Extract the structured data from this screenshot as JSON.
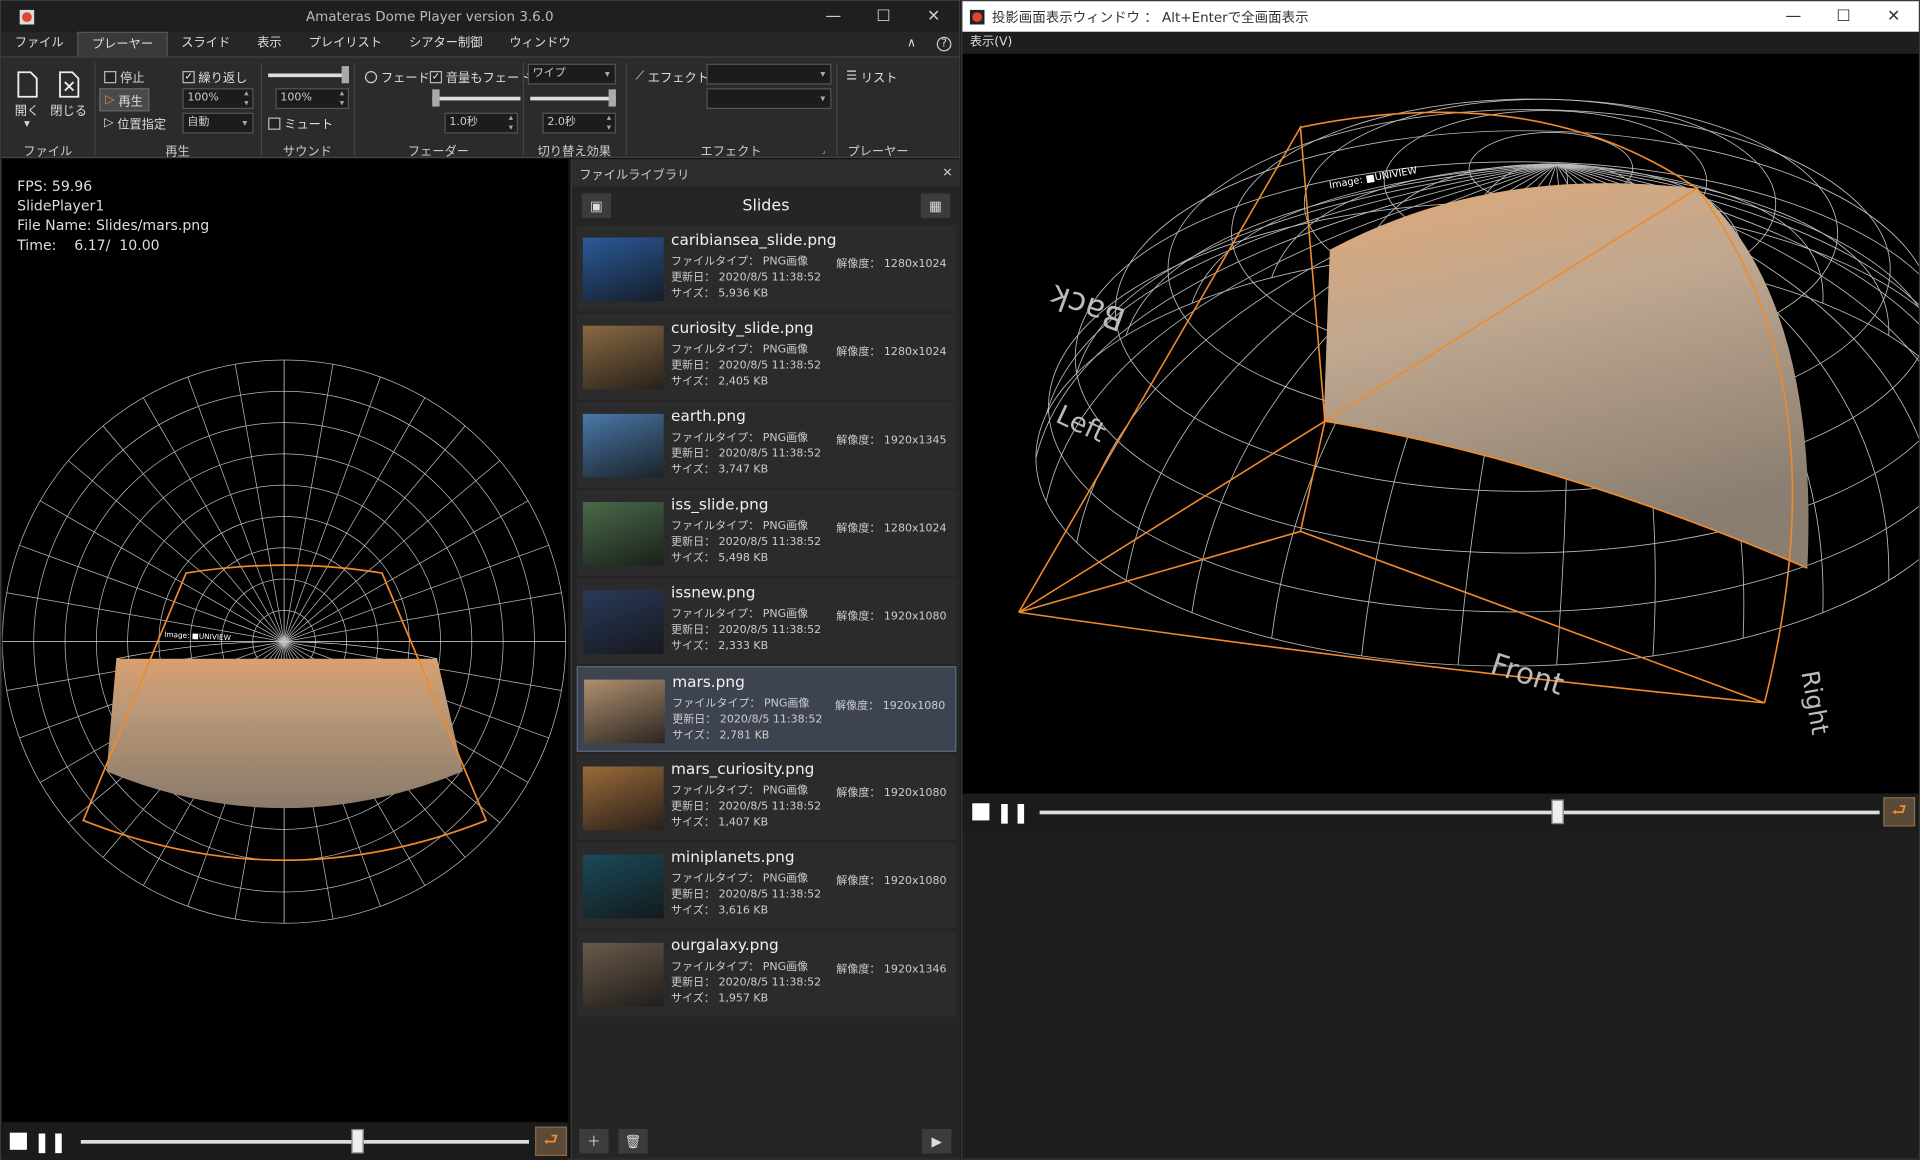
{
  "main_window": {
    "title": "Amateras Dome Player version 3.6.0",
    "menu": [
      "ファイル",
      "プレーヤー",
      "スライド",
      "表示",
      "プレイリスト",
      "シアター制御",
      "ウィンドウ"
    ],
    "active_menu_index": 1,
    "help_icon": "?"
  },
  "ribbon": {
    "file_group": {
      "open": "開く",
      "close": "閉じる",
      "label": "ファイル"
    },
    "play_group": {
      "stop": "停止",
      "play": "再生",
      "position": "位置指定",
      "repeat": "繰り返し",
      "repeat_checked": true,
      "speed": "100%",
      "mode": "自動",
      "label": "再生"
    },
    "sound_group": {
      "volume": "100%",
      "mute": "ミュート",
      "mute_checked": false,
      "label": "サウンド"
    },
    "fader_group": {
      "fade": "フェード",
      "sound_fade": "音量もフェード",
      "sound_fade_checked": true,
      "time1": "1.0秒",
      "label": "フェーダー"
    },
    "switch_group": {
      "effect": "ワイプ",
      "time": "2.0秒",
      "label": "切り替え効果"
    },
    "effect_group": {
      "effect": "エフェクト",
      "label": "エフェクト"
    },
    "player_group": {
      "list": "リスト",
      "label": "プレーヤー"
    }
  },
  "viewport_info": {
    "fps": "FPS: 59.96",
    "player": "SlidePlayer1",
    "file": "File Name: Slides/mars.png",
    "time": "Time:    6.17/  10.00"
  },
  "overlay_text": "Image: ■UNIVIEW",
  "library": {
    "header": "ファイルライブラリ",
    "title": "Slides",
    "type_label": "ファイルタイプ：",
    "date_label": "更新日：",
    "size_label": "サイズ：",
    "res_label": "解像度：",
    "files": [
      {
        "name": "caribiansea_slide.png",
        "type": "PNG画像",
        "date": "2020/8/5 11:38:52",
        "size": "5,936 KB",
        "res": "1280x1024",
        "color": "#2b5a9a"
      },
      {
        "name": "curiosity_slide.png",
        "type": "PNG画像",
        "date": "2020/8/5 11:38:52",
        "size": "2,405 KB",
        "res": "1280x1024",
        "color": "#8a6a44"
      },
      {
        "name": "earth.png",
        "type": "PNG画像",
        "date": "2020/8/5 11:38:52",
        "size": "3,747 KB",
        "res": "1920x1345",
        "color": "#4a78a8"
      },
      {
        "name": "iss_slide.png",
        "type": "PNG画像",
        "date": "2020/8/5 11:38:52",
        "size": "5,498 KB",
        "res": "1280x1024",
        "color": "#4a6a4a"
      },
      {
        "name": "issnew.png",
        "type": "PNG画像",
        "date": "2020/8/5 11:38:52",
        "size": "2,333 KB",
        "res": "1920x1080",
        "color": "#2a3a5a"
      },
      {
        "name": "mars.png",
        "type": "PNG画像",
        "date": "2020/8/5 11:38:52",
        "size": "2,781 KB",
        "res": "1920x1080",
        "color": "#b09070"
      },
      {
        "name": "mars_curiosity.png",
        "type": "PNG画像",
        "date": "2020/8/5 11:38:52",
        "size": "1,407 KB",
        "res": "1920x1080",
        "color": "#9a6a3a"
      },
      {
        "name": "miniplanets.png",
        "type": "PNG画像",
        "date": "2020/8/5 11:38:52",
        "size": "3,616 KB",
        "res": "1920x1080",
        "color": "#1a4a5a"
      },
      {
        "name": "ourgalaxy.png",
        "type": "PNG画像",
        "date": "2020/8/5 11:38:52",
        "size": "1,957 KB",
        "res": "1920x1346",
        "color": "#6a5a4a"
      }
    ],
    "selected_index": 5
  },
  "playback_progress": 0.617,
  "projection_window": {
    "title": "投影画面表示ウィンドウ ： Alt+Enterで全画面表示",
    "menu": "表示(V)",
    "labels": {
      "back": "Back",
      "left": "Left",
      "front": "Front",
      "right": "Right"
    }
  },
  "colors": {
    "accent": "#f08a2a",
    "bg": "#1e1e1e",
    "selected": "#3d4450"
  }
}
